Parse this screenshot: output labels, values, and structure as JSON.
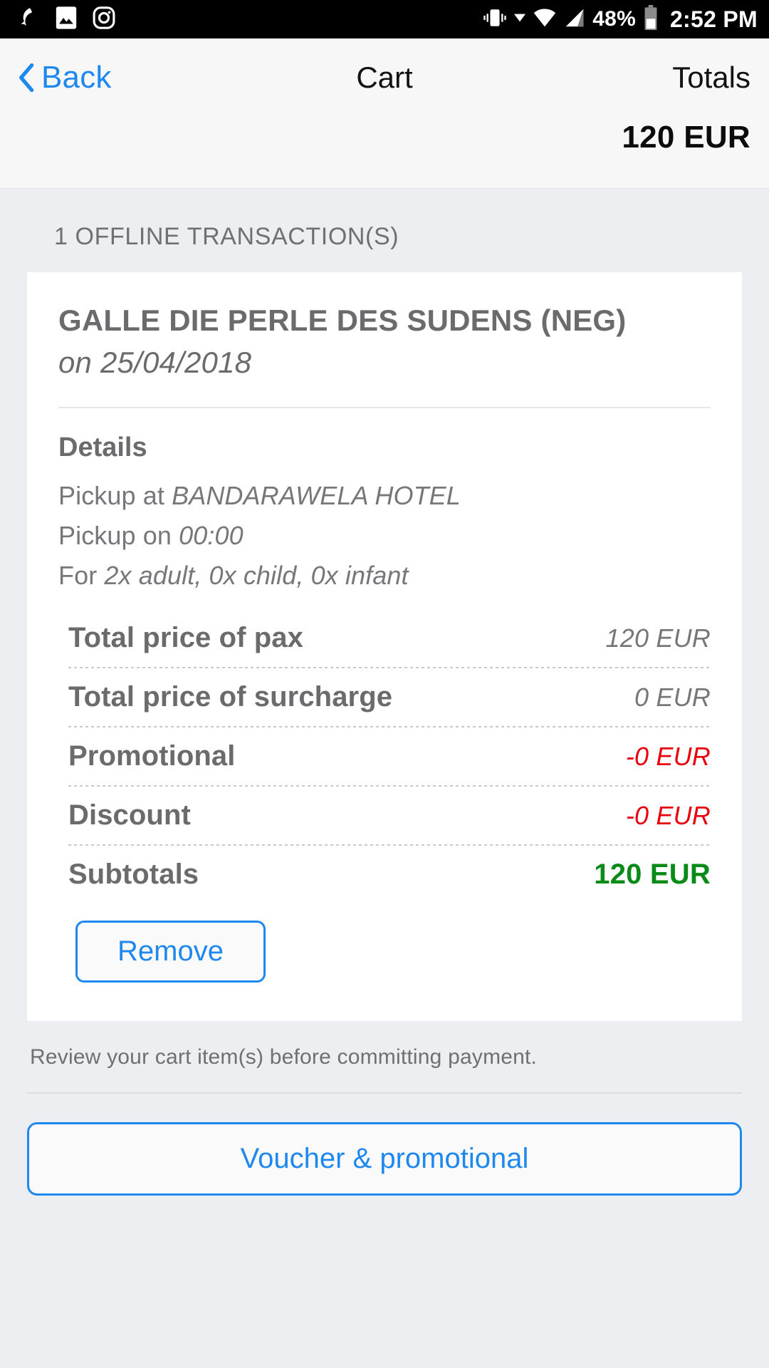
{
  "statusbar": {
    "icons": [
      "swipe-gesture-icon",
      "gallery-icon",
      "instagram-icon"
    ],
    "right_icons": [
      "vibrate-icon",
      "dropdown-caret-icon",
      "wifi-icon",
      "signal-icon",
      "battery-icon"
    ],
    "battery_percent": "48%",
    "clock": "2:52 PM"
  },
  "navbar": {
    "back_label": "Back",
    "title": "Cart",
    "totals_label": "Totals",
    "totals_amount": "120 EUR"
  },
  "section": {
    "header": "1 OFFLINE TRANSACTION(S)"
  },
  "cart_item": {
    "title": "GALLE DIE PERLE DES SUDENS (NEG)",
    "date_line": "on 25/04/2018",
    "details_heading": "Details",
    "detail_lines": [
      {
        "label": "Pickup at ",
        "value": "BANDARAWELA HOTEL"
      },
      {
        "label": "Pickup on ",
        "value": "00:00"
      },
      {
        "label": "For ",
        "value": "2x adult, 0x child, 0x infant"
      }
    ],
    "prices": [
      {
        "label": "Total price of pax",
        "value": "120 EUR",
        "style": "normal"
      },
      {
        "label": "Total price of surcharge",
        "value": "0 EUR",
        "style": "normal"
      },
      {
        "label": "Promotional",
        "value": "-0 EUR",
        "style": "neg"
      },
      {
        "label": "Discount",
        "value": "-0 EUR",
        "style": "neg"
      },
      {
        "label": "Subtotals",
        "value": "120 EUR",
        "style": "pos"
      }
    ],
    "remove_label": "Remove"
  },
  "footer": {
    "note": "Review your cart item(s) before committing payment.",
    "voucher_label": "Voucher & promotional"
  },
  "colors": {
    "accent": "#1e88ef",
    "negative": "#e8000d",
    "positive": "#0a8a17",
    "text_muted": "#6b6b6e",
    "page_bg": "#eceef1",
    "card_bg": "#ffffff",
    "nav_bg": "#f7f7f7"
  }
}
